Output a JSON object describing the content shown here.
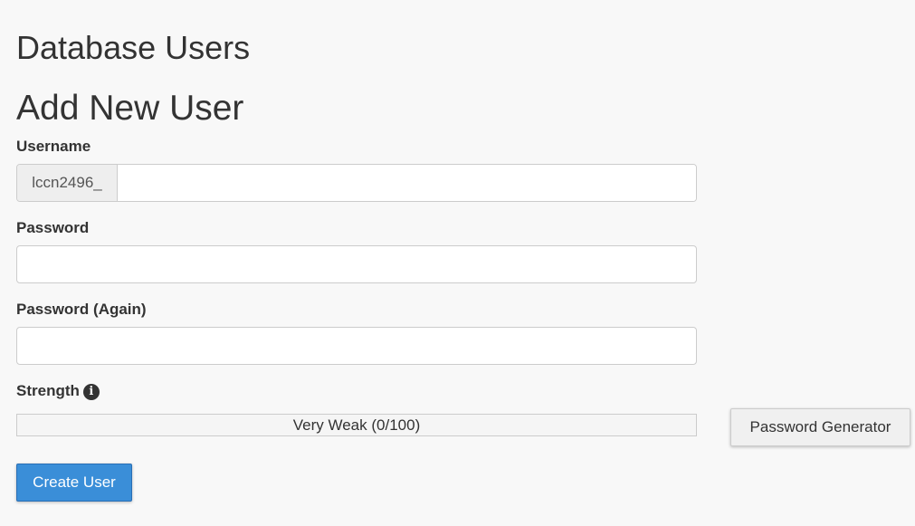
{
  "page": {
    "title": "Database Users",
    "section_title": "Add New User"
  },
  "form": {
    "username": {
      "label": "Username",
      "prefix": "lccn2496_",
      "value": ""
    },
    "password": {
      "label": "Password",
      "value": ""
    },
    "password_again": {
      "label": "Password (Again)",
      "value": ""
    },
    "strength": {
      "label": "Strength",
      "icon": "info-icon",
      "meter_text": "Very Weak (0/100)",
      "score": 0,
      "max": 100
    }
  },
  "buttons": {
    "password_generator": "Password Generator",
    "create_user": "Create User"
  },
  "colors": {
    "primary": "#3a8ed8",
    "background": "#f8f8f8",
    "meter_weak": "#d9534f"
  }
}
